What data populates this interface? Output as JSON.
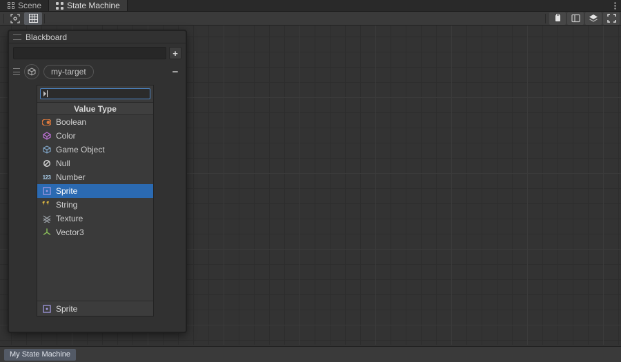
{
  "tabs": {
    "scene": "Scene",
    "state_machine": "State Machine"
  },
  "toolbar": {
    "frame_icon": "frame-icon",
    "grid_icon": "grid-icon",
    "clipboard_icon": "clipboard-icon",
    "panel_icon": "panel-icon",
    "layers_icon": "layers-icon",
    "fullscreen_icon": "fullscreen-icon"
  },
  "panel": {
    "title": "Blackboard",
    "search_placeholder": "",
    "add_label": "+",
    "entry_chip": "my-target",
    "collapse_label": "−"
  },
  "dropdown": {
    "search_placeholder": "",
    "title": "Value Type",
    "items": [
      {
        "label": "Boolean",
        "icon": "boolean-icon",
        "selected": false,
        "color": "#e07a3c"
      },
      {
        "label": "Color",
        "icon": "color-icon",
        "selected": false,
        "color": "#b86fd0"
      },
      {
        "label": "Game Object",
        "icon": "gameobject-icon",
        "selected": false,
        "color": "#7fa4c6"
      },
      {
        "label": "Null",
        "icon": "null-icon",
        "selected": false,
        "color": "#d6d6d6"
      },
      {
        "label": "Number",
        "icon": "number-icon",
        "selected": false,
        "color": "#a5c8e4",
        "text": "123"
      },
      {
        "label": "Sprite",
        "icon": "sprite-icon",
        "selected": true,
        "color": "#a098e0"
      },
      {
        "label": "String",
        "icon": "string-icon",
        "selected": false,
        "color": "#d8b341"
      },
      {
        "label": "Texture",
        "icon": "texture-icon",
        "selected": false,
        "color": "#9aa0a6"
      },
      {
        "label": "Vector3",
        "icon": "vector3-icon",
        "selected": false,
        "color": "#8bbf5a"
      }
    ],
    "footer": {
      "label": "Sprite",
      "icon": "sprite-icon",
      "color": "#a098e0"
    }
  },
  "footer": {
    "breadcrumb": "My State Machine"
  }
}
